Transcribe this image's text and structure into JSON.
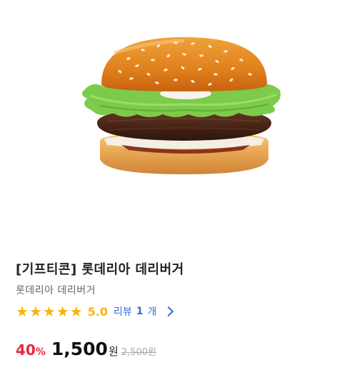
{
  "product": {
    "title": "[기프티콘] 롯데리아 데리버거",
    "brand_name": "롯데리아 데리버거",
    "image": "burger-photo"
  },
  "rating": {
    "star_count": 5,
    "score": "5.0",
    "review_label": "리뷰",
    "review_count": "1",
    "review_unit": "개"
  },
  "price": {
    "discount_value": "40",
    "discount_suffix": "%",
    "sale_price": "1,500",
    "currency": "원",
    "original_price": "2,500원"
  },
  "colors": {
    "star": "#f6b40d",
    "discount": "#e6283d",
    "link": "#2f6fd8"
  }
}
